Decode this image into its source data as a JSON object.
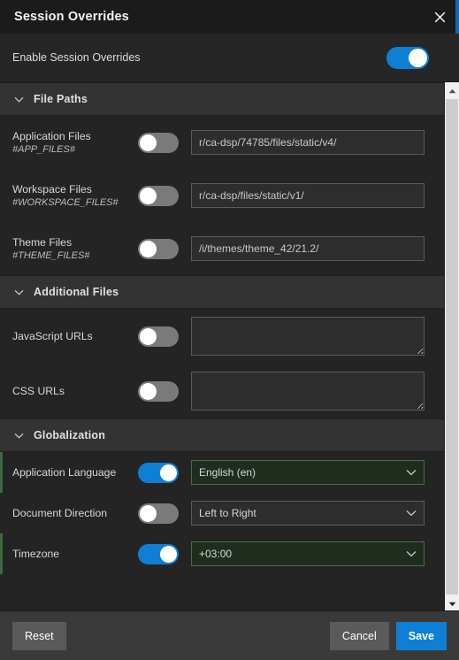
{
  "titlebar": {
    "title": "Session Overrides",
    "close_icon": "close-icon"
  },
  "master_toggle": {
    "label": "Enable Session Overrides",
    "enabled": true
  },
  "sections": [
    {
      "key": "file_paths",
      "title": "File Paths",
      "expanded": true,
      "chevron_icon": "chevron-down-icon"
    },
    {
      "key": "additional_files",
      "title": "Additional Files",
      "expanded": true,
      "chevron_icon": "chevron-down-icon"
    },
    {
      "key": "globalization",
      "title": "Globalization",
      "expanded": true,
      "chevron_icon": "chevron-down-icon"
    }
  ],
  "file_paths": {
    "rows": [
      {
        "label": "Application Files",
        "sublabel": "#APP_FILES#",
        "toggle_on": false,
        "value": "r/ca-dsp/74785/files/static/v4/",
        "placeholder": ""
      },
      {
        "label": "Workspace Files",
        "sublabel": "#WORKSPACE_FILES#",
        "toggle_on": false,
        "value": "r/ca-dsp/files/static/v1/",
        "placeholder": ""
      },
      {
        "label": "Theme Files",
        "sublabel": "#THEME_FILES#",
        "toggle_on": false,
        "value": "/i/themes/theme_42/21.2/",
        "placeholder": ""
      }
    ]
  },
  "additional_files": {
    "rows": [
      {
        "label": "JavaScript URLs",
        "sublabel": "",
        "toggle_on": false,
        "value": "",
        "placeholder": ""
      },
      {
        "label": "CSS URLs",
        "sublabel": "",
        "toggle_on": false,
        "value": "",
        "placeholder": ""
      }
    ]
  },
  "globalization": {
    "rows": [
      {
        "label": "Application Language",
        "sublabel": "",
        "toggle_on": true,
        "value": "English (en)",
        "chevron_icon": "chevron-down-icon"
      },
      {
        "label": "Document Direction",
        "sublabel": "",
        "toggle_on": false,
        "value": "Left to Right",
        "chevron_icon": "chevron-down-icon"
      },
      {
        "label": "Timezone",
        "sublabel": "",
        "toggle_on": true,
        "value": "+03:00",
        "chevron_icon": "chevron-down-icon"
      }
    ]
  },
  "scrollbar": {
    "up_icon": "scroll-up-arrow-icon",
    "down_icon": "scroll-down-arrow-icon"
  },
  "footer": {
    "reset_label": "Reset",
    "cancel_label": "Cancel",
    "save_label": "Save"
  },
  "colors": {
    "accent_blue": "#0f7fd6",
    "active_green": "#3f6b3f",
    "dialog_bg": "#2b2b2b",
    "titlebar_bg": "#1b1b1b",
    "section_header_bg": "#333333",
    "footer_bg": "#3a3a3a"
  }
}
